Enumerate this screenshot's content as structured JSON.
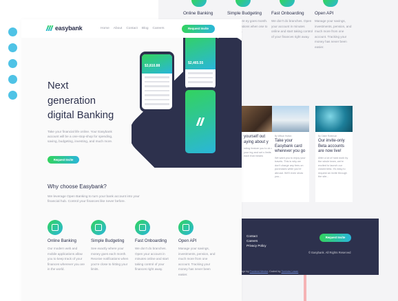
{
  "brand": {
    "name": "easybank"
  },
  "nav": [
    "Home",
    "About",
    "Contact",
    "Blog",
    "Careers"
  ],
  "header_cta": "Request Invite",
  "hero": {
    "title_lines": [
      "Next",
      "generation",
      "digital Banking"
    ],
    "text": "Take your financial life online. Your Easybank account will be a one-stop-shop for spending, saving, budgeting, investing, and much more.",
    "cta": "Request Invite"
  },
  "phones": {
    "amounts": [
      "$3,810.88",
      "$2,465.55"
    ]
  },
  "why": {
    "title": "Why choose Easybank?",
    "text": "We leverage Open Banking to turn your bank account into your financial hub. Control your finances like never before."
  },
  "features": [
    {
      "title": "Online Banking",
      "text": "Our modern web and mobile applications allow you to keep track of your finances wherever you are in the world."
    },
    {
      "title": "Simple Budgeting",
      "text": "See exactly where your money goes each month. Receive notifications when you're close to hitting your limits."
    },
    {
      "title": "Fast Onboarding",
      "text": "We don't do branches. Open your account in minutes online and start taking control of your finances right away."
    },
    {
      "title": "Open API",
      "text": "Manage your savings, investments, pension, and much more from one account. Tracking your money has never been easier."
    }
  ],
  "back_features": [
    {
      "title": "Online Banking",
      "text": ""
    },
    {
      "title": "Simple Budgeting",
      "text": "xactly where ey goes month. Receive cations when ose to your limits."
    },
    {
      "title": "Fast Onboarding",
      "text": "We don't do branches. Open your account in minutes online and start taking control of your finances right away."
    },
    {
      "title": "Open API",
      "text": "Manage your savings, investments, pension, and much more from one account. Tracking your money has never been easier."
    }
  ],
  "articles": [
    {
      "by": "",
      "title": "yourself out aying about y",
      "text": "nding feature you to ck out your ing and set s limits each that means"
    },
    {
      "by": "By Wilson Hutton",
      "title": "Take your Easybank card wherever you go",
      "text": "We want you to enjoy your travels. This is why we don't charge any fees on purchases while you're abroad. We'll even show you..."
    },
    {
      "by": "By Claire Robinson",
      "title": "Our invite-only Beta accounts are now live!",
      "text": "After a lot of hard work by the whole team, we're excited to launch our closed beta. It's easy to request an invite through the site..."
    }
  ],
  "footer": {
    "links": [
      "Contact",
      "Careers",
      "Privacy Policy"
    ],
    "cta": "Request Invite",
    "copyright": "© Easybank. All Rights Reserved",
    "credit_prefix": "nge by",
    "credit_link_1": "Frontend Mentor",
    "credit_mid": ". Coded by",
    "credit_link_2": "Tomislav Lasan"
  },
  "colors": {
    "primary": "#2d314d",
    "green": "#31d35c",
    "cyan": "#2bb7da",
    "gray": "#9597a3",
    "dot": "#4fc3e6"
  }
}
